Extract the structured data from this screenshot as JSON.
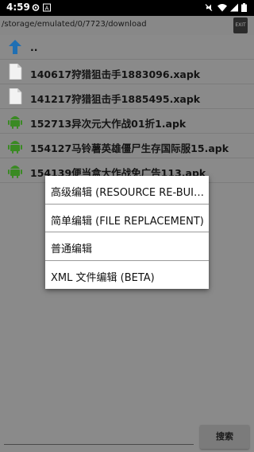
{
  "status_bar": {
    "time": "4:59",
    "icons": [
      "settings-gear-icon",
      "a-notification-icon",
      "mute-icon",
      "wifi-icon",
      "signal-icon",
      "battery-icon"
    ]
  },
  "path_bar": {
    "path": "/storage/emulated/0/7723/download",
    "exit_label": "EXIT"
  },
  "file_list": [
    {
      "icon": "up-arrow-icon",
      "name": ".."
    },
    {
      "icon": "file-icon",
      "name": "140617狩猎狙击手1883096.xapk"
    },
    {
      "icon": "file-icon",
      "name": "141217狩猎狙击手1885495.xapk"
    },
    {
      "icon": "android-apk-icon",
      "name": "152713异次元大作战01折1.apk"
    },
    {
      "icon": "android-apk-icon",
      "name": "154127马铃薯英雄僵尸生存国际服15.apk"
    },
    {
      "icon": "android-apk-icon",
      "name": "154139便当盒大作战免广告113.apk"
    }
  ],
  "menu": {
    "items": [
      "高级编辑 (RESOURCE RE-BUILD)",
      "简单编辑 (FILE REPLACEMENT)",
      "普通编辑",
      "XML 文件编辑 (BETA)"
    ]
  },
  "search": {
    "placeholder": "",
    "button_label": "搜索"
  },
  "colors": {
    "background": "#8a8a8a",
    "menu_background": "#ffffff",
    "accent_up_arrow": "#1f6fb3",
    "android_green": "#3a8a23"
  }
}
